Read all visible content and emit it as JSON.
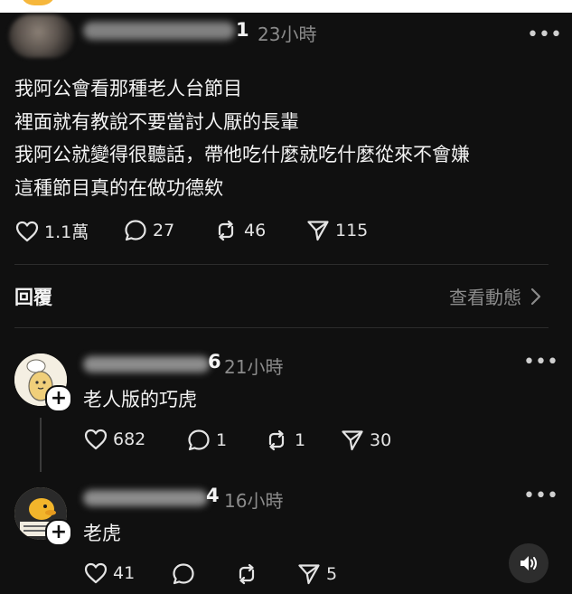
{
  "post": {
    "author_suffix": "1",
    "time": "23小時",
    "lines": [
      "我阿公會看那種老人台節目",
      "裡面就有教說不要當討人厭的長輩",
      "我阿公就變得很聽話，帶他吃什麼就吃什麼從來不會嫌",
      "這種節目真的在做功德欸"
    ],
    "likes": "1.1萬",
    "comments": "27",
    "reposts": "46",
    "shares": "115"
  },
  "replies_section": {
    "title": "回覆",
    "view_activity": "查看動態"
  },
  "replies": [
    {
      "author_suffix": "6",
      "time": "21小時",
      "text": "老人版的巧虎",
      "likes": "682",
      "comments": "1",
      "reposts": "1",
      "shares": "30"
    },
    {
      "author_suffix": "4",
      "time": "16小時",
      "text": "老虎",
      "likes": "41",
      "comments": "",
      "reposts": "",
      "shares": "5"
    }
  ],
  "icons": {
    "like": "heart-icon",
    "comment": "comment-icon",
    "repost": "repost-icon",
    "share": "send-icon",
    "more": "more-icon",
    "chevron": "chevron-right-icon",
    "audio": "speaker-icon",
    "follow": "plus-icon"
  },
  "colors": {
    "background": "#101010",
    "text": "#f3f3f3",
    "secondary_text": "#8b8b8b"
  }
}
